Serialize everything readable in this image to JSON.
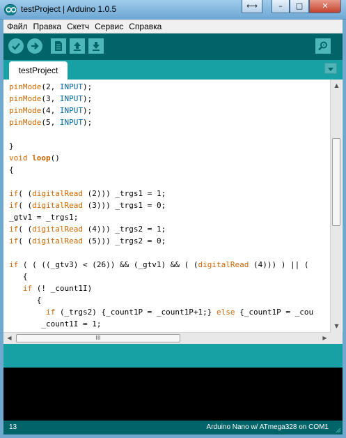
{
  "window": {
    "title": "testProject | Arduino 1.0.5",
    "restore_glyph": "⟷",
    "minimize_glyph": "–",
    "maximize_glyph": "□",
    "close_glyph": "✕"
  },
  "menu": {
    "items": [
      "Файл",
      "Правка",
      "Скетч",
      "Сервис",
      "Справка"
    ]
  },
  "toolbar": {
    "buttons": [
      {
        "name": "verify",
        "icon": "check-icon"
      },
      {
        "name": "upload",
        "icon": "arrow-right-icon"
      },
      {
        "name": "new",
        "icon": "document-icon"
      },
      {
        "name": "open",
        "icon": "arrow-up-icon"
      },
      {
        "name": "save",
        "icon": "arrow-down-icon"
      },
      {
        "name": "serial-monitor",
        "icon": "magnifier-icon"
      }
    ]
  },
  "tabs": {
    "active": "testProject",
    "menu_icon": "triangle-down-icon"
  },
  "editor": {
    "lines": [
      [
        [
          "fn",
          "pinMode"
        ],
        [
          "txt",
          "(2, "
        ],
        [
          "const",
          "INPUT"
        ],
        [
          "txt",
          ");"
        ]
      ],
      [
        [
          "fn",
          "pinMode"
        ],
        [
          "txt",
          "(3, "
        ],
        [
          "const",
          "INPUT"
        ],
        [
          "txt",
          ");"
        ]
      ],
      [
        [
          "fn",
          "pinMode"
        ],
        [
          "txt",
          "(4, "
        ],
        [
          "const",
          "INPUT"
        ],
        [
          "txt",
          ");"
        ]
      ],
      [
        [
          "fn",
          "pinMode"
        ],
        [
          "txt",
          "(5, "
        ],
        [
          "const",
          "INPUT"
        ],
        [
          "txt",
          ");"
        ]
      ],
      [],
      [
        [
          "txt",
          "}"
        ]
      ],
      [
        [
          "kw",
          "void"
        ],
        [
          "txt",
          " "
        ],
        [
          "kwb",
          "loop"
        ],
        [
          "txt",
          "()"
        ]
      ],
      [
        [
          "txt",
          "{"
        ]
      ],
      [],
      [
        [
          "kw",
          "if"
        ],
        [
          "txt",
          "( ("
        ],
        [
          "fn",
          "digitalRead"
        ],
        [
          "txt",
          " (2))) _trgs1 = 1;"
        ]
      ],
      [
        [
          "kw",
          "if"
        ],
        [
          "txt",
          "( ("
        ],
        [
          "fn",
          "digitalRead"
        ],
        [
          "txt",
          " (3))) _trgs1 = 0;"
        ]
      ],
      [
        [
          "txt",
          "_gtv1 = _trgs1;"
        ]
      ],
      [
        [
          "kw",
          "if"
        ],
        [
          "txt",
          "( ("
        ],
        [
          "fn",
          "digitalRead"
        ],
        [
          "txt",
          " (4))) _trgs2 = 1;"
        ]
      ],
      [
        [
          "kw",
          "if"
        ],
        [
          "txt",
          "( ("
        ],
        [
          "fn",
          "digitalRead"
        ],
        [
          "txt",
          " (5))) _trgs2 = 0;"
        ]
      ],
      [],
      [
        [
          "kw",
          "if"
        ],
        [
          "txt",
          " ( ( ((_gtv3) < (26)) && (_gtv1) && ( ("
        ],
        [
          "fn",
          "digitalRead"
        ],
        [
          "txt",
          " (4))) ) || ("
        ]
      ],
      [
        [
          "txt",
          "   {"
        ]
      ],
      [
        [
          "txt",
          "   "
        ],
        [
          "kw",
          "if"
        ],
        [
          "txt",
          " (! _count1I)"
        ]
      ],
      [
        [
          "txt",
          "      {"
        ]
      ],
      [
        [
          "txt",
          "        "
        ],
        [
          "kw",
          "if"
        ],
        [
          "txt",
          " (_trgs2) {_count1P = _count1P+1;} "
        ],
        [
          "kw",
          "else"
        ],
        [
          "txt",
          " {_count1P = _cou"
        ]
      ],
      [
        [
          "txt",
          "       _count1I = 1;"
        ]
      ]
    ]
  },
  "scrollbars": {
    "up_glyph": "▲",
    "down_glyph": "▼",
    "left_glyph": "◀",
    "right_glyph": "▶",
    "grip_glyph": "III"
  },
  "status": {
    "line_number": "13",
    "board": "Arduino Nano w/ ATmega328 on COM1"
  }
}
